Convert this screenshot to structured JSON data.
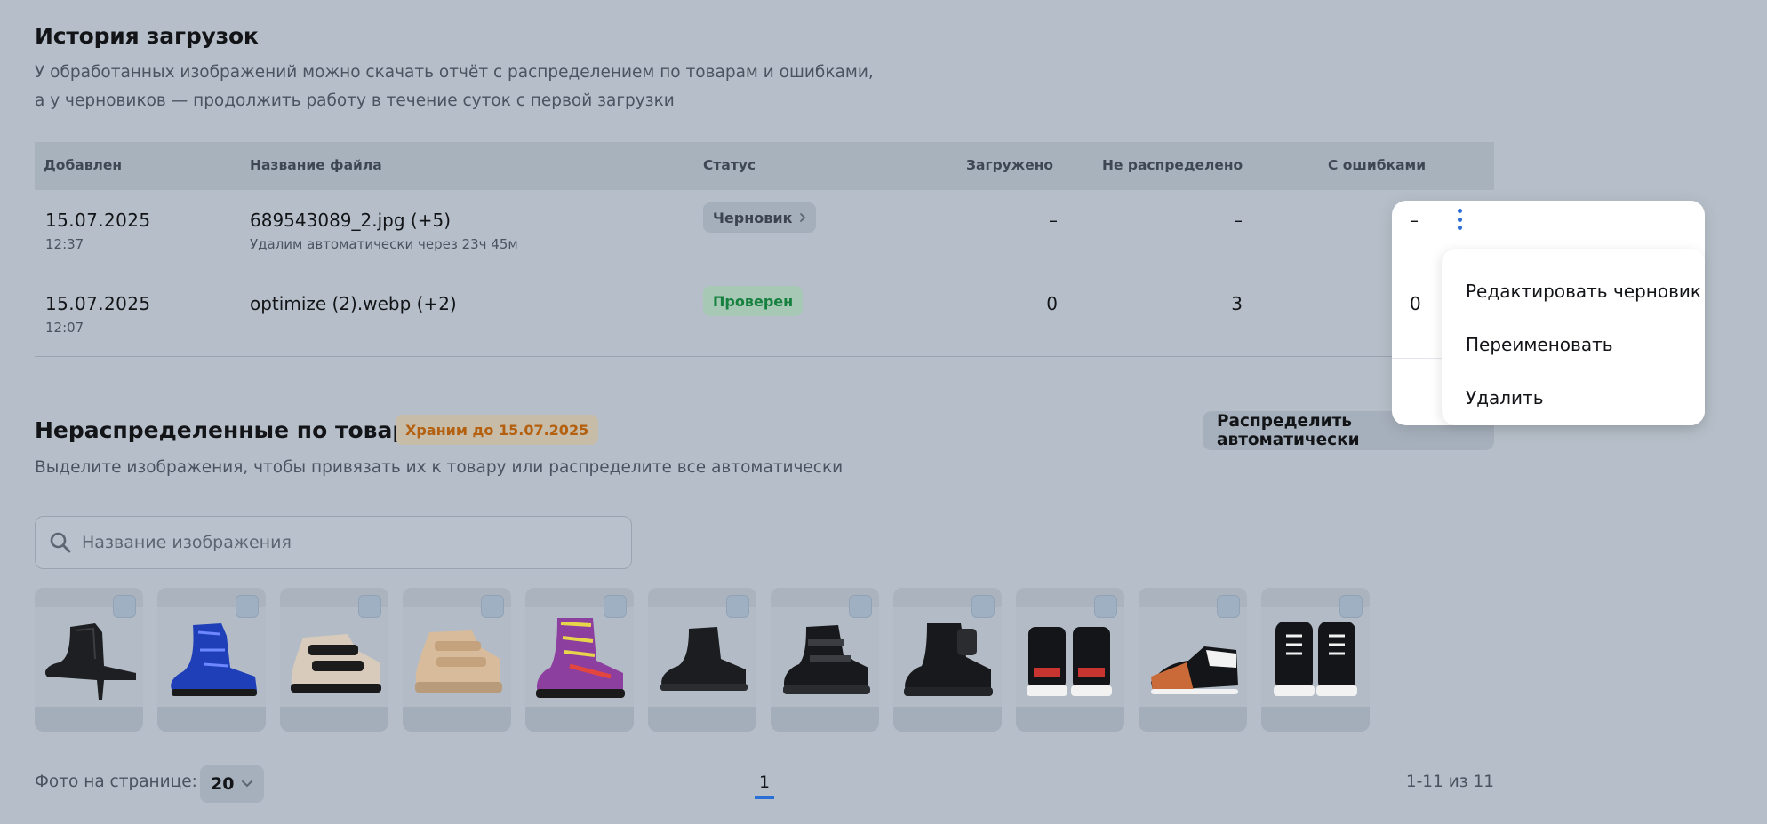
{
  "history": {
    "title": "История загрузок",
    "subtitle_line1": "У обработанных изображений можно скачать отчёт с распределением по товарам и ошибками,",
    "subtitle_line2": "а у черновиков — продолжить работу в течение суток с первой загрузки",
    "columns": {
      "added": "Добавлен",
      "filename": "Название файла",
      "status": "Статус",
      "uploaded": "Загружено",
      "unassigned": "Не распределено",
      "errors": "С ошибками"
    },
    "rows": [
      {
        "date": "15.07.2025",
        "time": "12:37",
        "filename": "689543089_2.jpg (+5)",
        "note": "Удалим автоматически через 23ч 45м",
        "status": "Черновик",
        "uploaded": "–",
        "unassigned": "–",
        "errors": "–"
      },
      {
        "date": "15.07.2025",
        "time": "12:07",
        "filename": "optimize (2).webp (+2)",
        "note": "",
        "status": "Проверен",
        "uploaded": "0",
        "unassigned": "3",
        "errors": "0"
      }
    ]
  },
  "menu": {
    "items": [
      "Редактировать черновик",
      "Переименовать",
      "Удалить"
    ]
  },
  "unassigned": {
    "title": "Нераспределенные по товарам",
    "keep_badge": "Храним до 15.07.2025",
    "auto_button": "Распределить автоматически",
    "hint": "Выделите изображения, чтобы привязать их к товару или распределите все автоматически",
    "search_placeholder": "Название изображения",
    "images": [
      {
        "icon": "black-heeled-ankle-boot"
      },
      {
        "icon": "blue-metallic-boot"
      },
      {
        "icon": "beige-black-velcro-shoe"
      },
      {
        "icon": "gold-velcro-boot"
      },
      {
        "icon": "graffiti-lace-up-boot"
      },
      {
        "icon": "black-chelsea-boot"
      },
      {
        "icon": "black-buckle-boot"
      },
      {
        "icon": "black-pouch-combat-boot"
      },
      {
        "icon": "black-high-top-sneakers-back"
      },
      {
        "icon": "black-high-top-sneaker-side"
      },
      {
        "icon": "black-high-top-sneakers-front"
      }
    ]
  },
  "footer": {
    "per_page_label": "Фото на странице:",
    "per_page_value": "20",
    "current_page": "1",
    "range": "1-11 из 11"
  },
  "colors": {
    "accent": "#2a6fd6",
    "draft_badge_text": "#3c4450",
    "ok_badge_text": "#16803f",
    "keep_badge_text": "#b4600e"
  }
}
